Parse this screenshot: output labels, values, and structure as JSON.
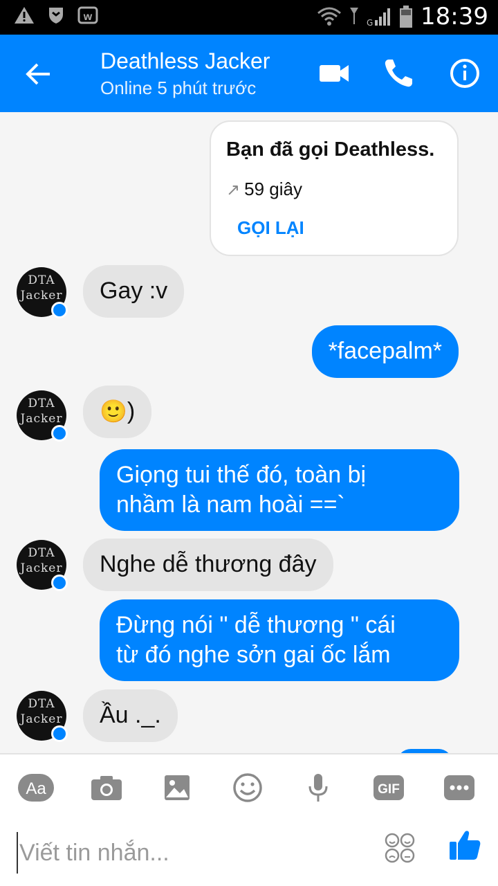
{
  "status_bar": {
    "time": "18:39"
  },
  "header": {
    "contact_name": "Deathless Jacker",
    "contact_status": "Online 5 phút trước",
    "icons": [
      "back-arrow-icon",
      "video-call-icon",
      "phone-icon",
      "info-icon"
    ]
  },
  "call_card": {
    "title": "Bạn đã gọi Deathless.",
    "arrow": "↗",
    "duration": "59 giây",
    "action": "GỌI LẠI"
  },
  "avatar_text": {
    "line1": "DTA",
    "line2": "Jacker"
  },
  "messages": [
    {
      "side": "in",
      "text": "Gay :v"
    },
    {
      "side": "out",
      "text": "*facepalm*"
    },
    {
      "side": "in",
      "text": ")",
      "emoji": "🙂"
    },
    {
      "side": "out",
      "lines": [
        "Giọng tui thế đó, toàn bị",
        "nhầm là nam hoài ==`"
      ]
    },
    {
      "side": "in",
      "text": "Nghe dễ thương đây"
    },
    {
      "side": "out",
      "lines": [
        "Đừng nói \" dễ thương \" cái",
        "từ đó nghe sởn gai ốc lắm"
      ]
    },
    {
      "side": "in",
      "text": "Ầu ._."
    }
  ],
  "composer": {
    "placeholder": "Viết tin nhắn...",
    "gif_label": "GIF",
    "aa_label": "Aa",
    "tools": [
      "text-format-icon",
      "camera-icon",
      "image-icon",
      "emoji-icon",
      "microphone-icon",
      "gif-icon",
      "more-icon"
    ]
  },
  "colors": {
    "accent": "#0084ff",
    "incoming_bubble": "#e4e4e4",
    "status_bar": "#000000"
  }
}
